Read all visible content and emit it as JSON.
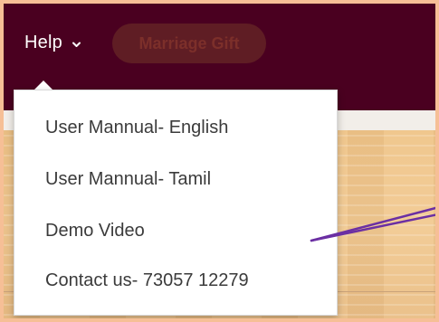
{
  "navbar": {
    "help_label": "Help",
    "help_chevron_icon": "chevron-down-icon",
    "pill_label": "Marriage Gift"
  },
  "help_dropdown": {
    "items": [
      {
        "label": "User Mannual- English"
      },
      {
        "label": "User Mannual- Tamil"
      },
      {
        "label": "Demo Video"
      },
      {
        "label": "Contact us- 73057 12279"
      }
    ]
  },
  "colors": {
    "navbar_bg": "#4a0020",
    "border_accent": "#f6bf96",
    "annotation_arrow": "#6b2fa3",
    "pill_bg": "#5f1d24"
  }
}
